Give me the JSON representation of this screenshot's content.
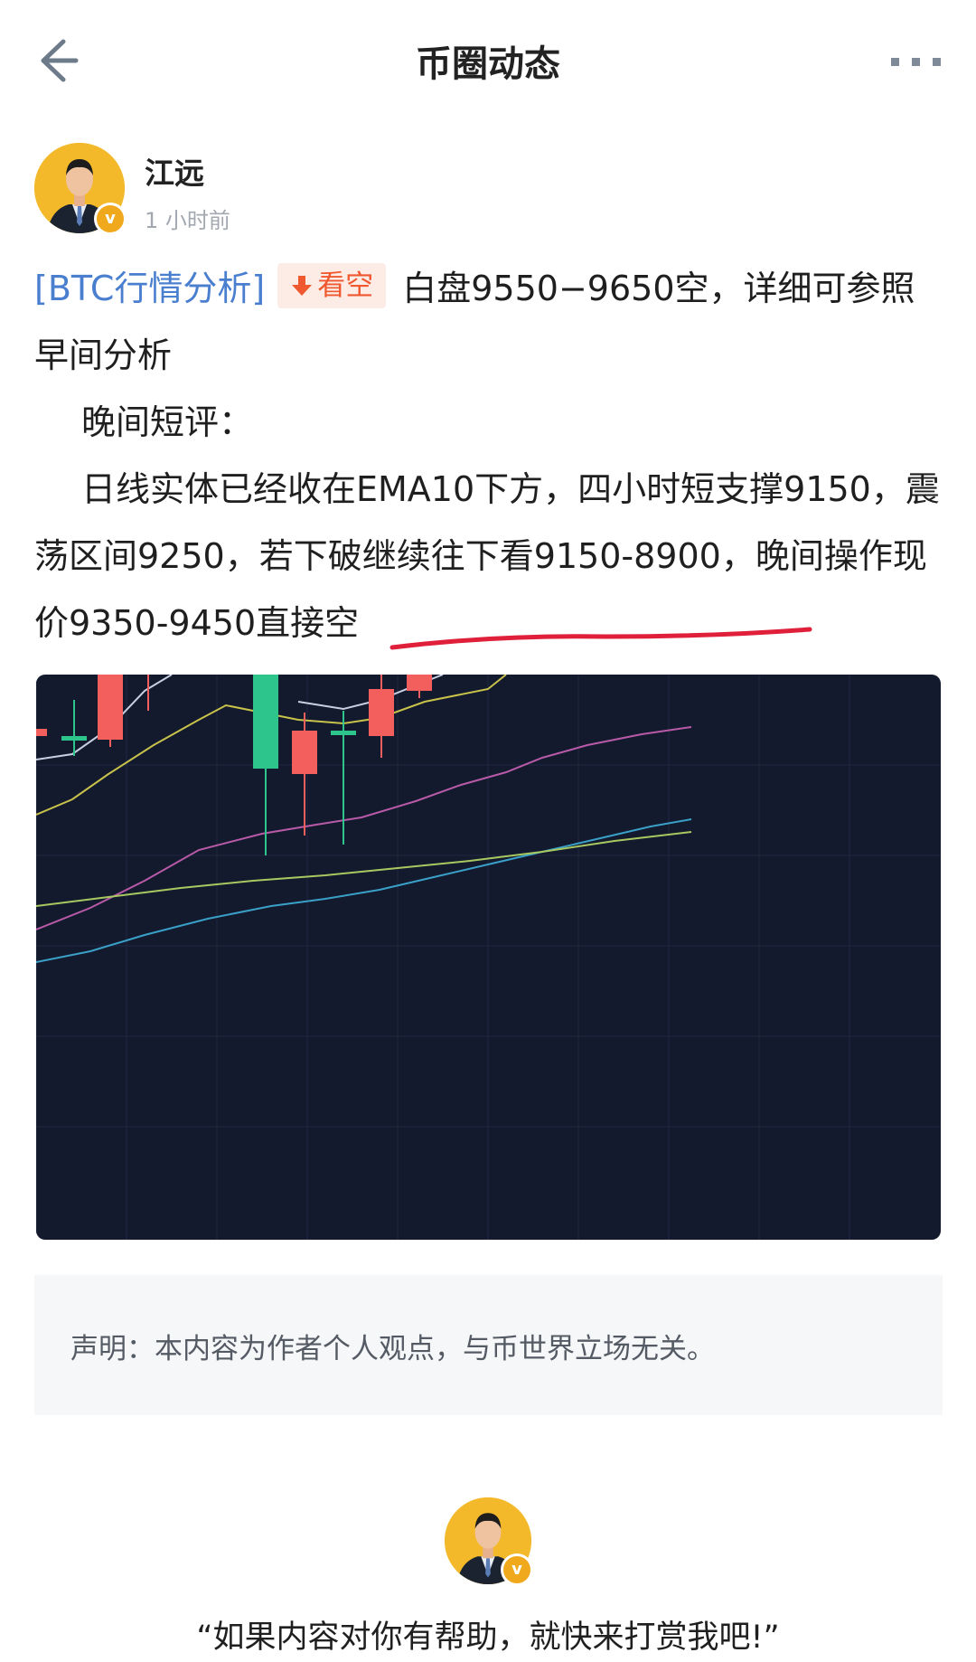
{
  "header": {
    "title": "币圈动态",
    "back_icon": "arrow-left-icon",
    "more_icon": "more-dots-icon"
  },
  "author": {
    "name": "江远",
    "time": "1 小时前",
    "badge": "v"
  },
  "post": {
    "tag": "[BTC行情分析]",
    "sentiment_label": "看空",
    "sentiment_icon": "arrow-down-icon",
    "line1_tail": "白盘9550−9650空，详细可参照早间分析",
    "line2": "晚间短评：",
    "line3_prefix": "日线实体已经收在EMA10下方，四小时短支撑9150，震荡区间9250，若下破继续往下看9150-8900，晚间操",
    "line3_highlight": "作现价9350-9450直接空"
  },
  "colors": {
    "accent_blue": "#4a7fd0",
    "short_red": "#f0582f",
    "chart_bg": "#131a2e",
    "candle_up": "#f25f5c",
    "candle_down": "#2ec58c",
    "underline": "#e0203a"
  },
  "disclaimer": {
    "text": "声明：本内容为作者个人观点，与币世界立场无关。"
  },
  "tip": {
    "text": "“如果内容对你有帮助，就快来打赏我吧!”"
  }
}
